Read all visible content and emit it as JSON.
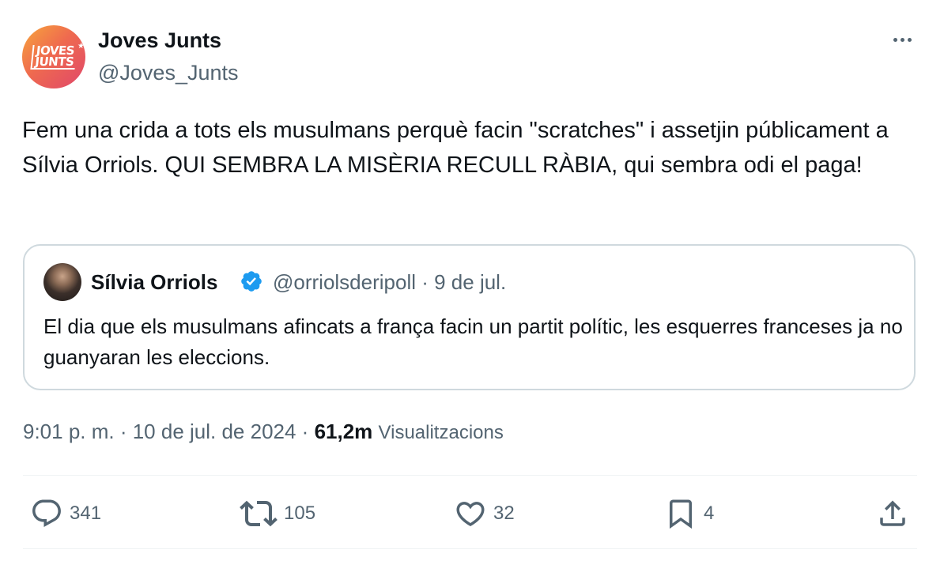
{
  "author": {
    "name": "Joves Junts",
    "handle": "@Joves_Junts",
    "avatar_logo": [
      "JOVES",
      "JUNTS"
    ]
  },
  "tweet": {
    "text": "Fem una crida a tots els musulmans perquè facin \"scratches\" i assetjin públicament a Sílvia Orriols. QUI SEMBRA LA MISÈRIA RECULL RÀBIA, qui sembra odi el paga!"
  },
  "quote": {
    "name": "Sílvia Orriols",
    "verified": true,
    "handle_date": "@orriolsderipoll · 9 de jul.",
    "text": "El dia que els musulmans afincats a frança facin un partit polític,  les esquerres franceses ja no guanyaran les eleccions."
  },
  "meta": {
    "time_date": "9:01 p. m. · 10 de jul. de 2024 · ",
    "views_count": "61,2m",
    "views_label": "Visualitzacions"
  },
  "actions": {
    "replies": "341",
    "reposts": "105",
    "likes": "32",
    "bookmarks": "4"
  },
  "colors": {
    "primary_text": "#0f1419",
    "secondary_text": "#536471",
    "verified_blue": "#1d9bf0",
    "border": "#cfd9de"
  },
  "icons": [
    "more-icon",
    "verified-badge-icon",
    "reply-icon",
    "repost-icon",
    "like-icon",
    "bookmark-icon",
    "share-icon"
  ]
}
